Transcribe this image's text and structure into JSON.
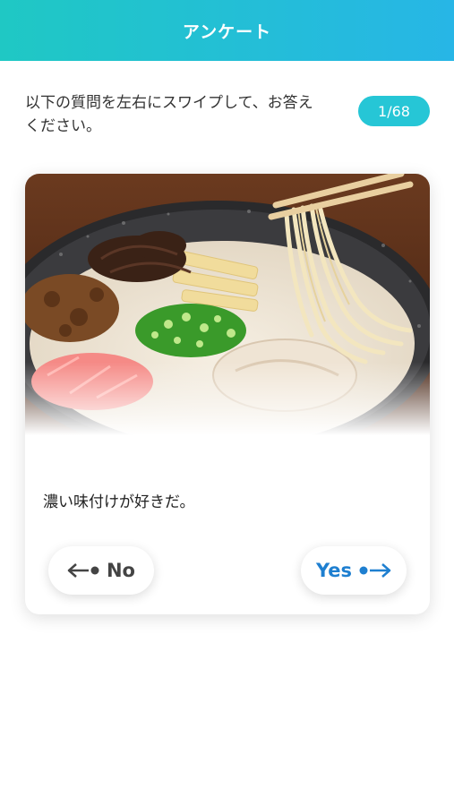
{
  "header": {
    "title": "アンケート"
  },
  "instruction": {
    "text": "以下の質問を左右にスワイプして、お答えください。"
  },
  "counter": {
    "text": "1/68"
  },
  "card": {
    "image": "ramen-bowl-photo",
    "question": "濃い味付けが好きだ。",
    "no_label": "No",
    "yes_label": "Yes"
  },
  "colors": {
    "header_start": "#1fc8c4",
    "header_end": "#27b6e6",
    "counter_bg": "#26c6d6",
    "yes_text": "#1e7fd0",
    "no_text": "#444444"
  },
  "icons": {
    "no": "arrow-left-dot-icon",
    "yes": "arrow-right-dot-icon"
  }
}
